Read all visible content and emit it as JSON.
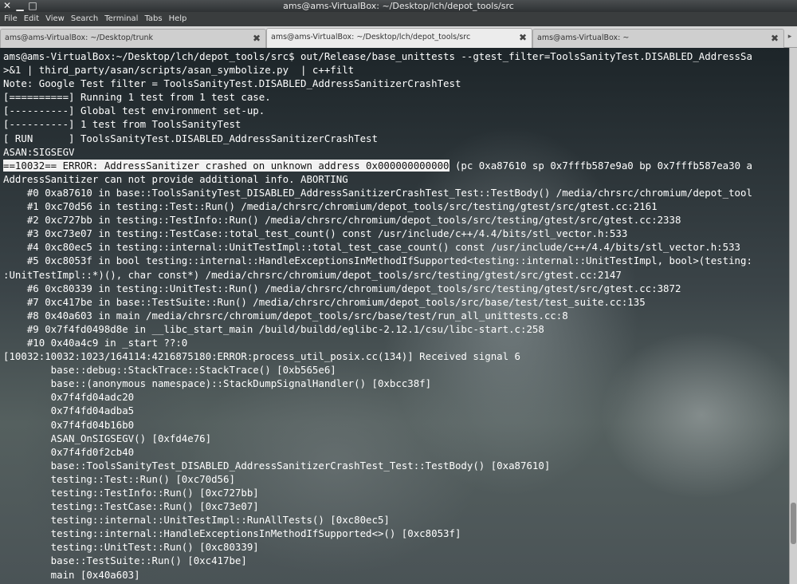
{
  "window": {
    "title": "ams@ams-VirtualBox: ~/Desktop/lch/depot_tools/src",
    "close_glyph": "✕",
    "minimize_glyph": "▁",
    "maximize_glyph": "□"
  },
  "menu": [
    "File",
    "Edit",
    "View",
    "Search",
    "Terminal",
    "Tabs",
    "Help"
  ],
  "tabs": [
    {
      "label": "ams@ams-VirtualBox: ~/Desktop/trunk",
      "close": "✖"
    },
    {
      "label": "ams@ams-VirtualBox: ~/Desktop/lch/depot_tools/src",
      "close": "✖"
    },
    {
      "label": "ams@ams-VirtualBox: ~",
      "close": "✖"
    }
  ],
  "tab_scroll_glyph": "▸",
  "terminal": {
    "error_highlight": "==10032== ERROR: AddressSanitizer crashed on unknown address 0x000000000000",
    "error_rest": " (pc 0xa87610 sp 0x7fffb587e9a0 bp 0x7fffb587ea30 a",
    "scroll_position_fraction": 0.92,
    "lines_before": [
      "ams@ams-VirtualBox:~/Desktop/lch/depot_tools/src$ out/Release/base_unittests --gtest_filter=ToolsSanityTest.DISABLED_AddressSa",
      ">&1 | third_party/asan/scripts/asan_symbolize.py  | c++filt",
      "Note: Google Test filter = ToolsSanityTest.DISABLED_AddressSanitizerCrashTest",
      "[==========] Running 1 test from 1 test case.",
      "[----------] Global test environment set-up.",
      "[----------] 1 test from ToolsSanityTest",
      "[ RUN      ] ToolsSanityTest.DISABLED_AddressSanitizerCrashTest",
      "ASAN:SIGSEGV"
    ],
    "lines_after": [
      "AddressSanitizer can not provide additional info. ABORTING",
      "    #0 0xa87610 in base::ToolsSanityTest_DISABLED_AddressSanitizerCrashTest_Test::TestBody() /media/chrsrc/chromium/depot_tool",
      "    #1 0xc70d56 in testing::Test::Run() /media/chrsrc/chromium/depot_tools/src/testing/gtest/src/gtest.cc:2161",
      "    #2 0xc727bb in testing::TestInfo::Run() /media/chrsrc/chromium/depot_tools/src/testing/gtest/src/gtest.cc:2338",
      "    #3 0xc73e07 in testing::TestCase::total_test_count() const /usr/include/c++/4.4/bits/stl_vector.h:533",
      "    #4 0xc80ec5 in testing::internal::UnitTestImpl::total_test_case_count() const /usr/include/c++/4.4/bits/stl_vector.h:533",
      "    #5 0xc8053f in bool testing::internal::HandleExceptionsInMethodIfSupported<testing::internal::UnitTestImpl, bool>(testing:",
      ":UnitTestImpl::*)(), char const*) /media/chrsrc/chromium/depot_tools/src/testing/gtest/src/gtest.cc:2147",
      "    #6 0xc80339 in testing::UnitTest::Run() /media/chrsrc/chromium/depot_tools/src/testing/gtest/src/gtest.cc:3872",
      "    #7 0xc417be in base::TestSuite::Run() /media/chrsrc/chromium/depot_tools/src/base/test/test_suite.cc:135",
      "    #8 0x40a603 in main /media/chrsrc/chromium/depot_tools/src/base/test/run_all_unittests.cc:8",
      "    #9 0x7f4fd0498d8e in __libc_start_main /build/buildd/eglibc-2.12.1/csu/libc-start.c:258",
      "    #10 0x40a4c9 in _start ??:0",
      "[10032:10032:1023/164114:4216875180:ERROR:process_util_posix.cc(134)] Received signal 6",
      "        base::debug::StackTrace::StackTrace() [0xb565e6]",
      "        base::(anonymous namespace)::StackDumpSignalHandler() [0xbcc38f]",
      "        0x7f4fd04adc20",
      "        0x7f4fd04adba5",
      "        0x7f4fd04b16b0",
      "        ASAN_OnSIGSEGV() [0xfd4e76]",
      "        0x7f4fd0f2cb40",
      "        base::ToolsSanityTest_DISABLED_AddressSanitizerCrashTest_Test::TestBody() [0xa87610]",
      "        testing::Test::Run() [0xc70d56]",
      "        testing::TestInfo::Run() [0xc727bb]",
      "        testing::TestCase::Run() [0xc73e07]",
      "        testing::internal::UnitTestImpl::RunAllTests() [0xc80ec5]",
      "        testing::internal::HandleExceptionsInMethodIfSupported<>() [0xc8053f]",
      "        testing::UnitTest::Run() [0xc80339]",
      "        base::TestSuite::Run() [0xc417be]",
      "        main [0x40a603]"
    ]
  }
}
